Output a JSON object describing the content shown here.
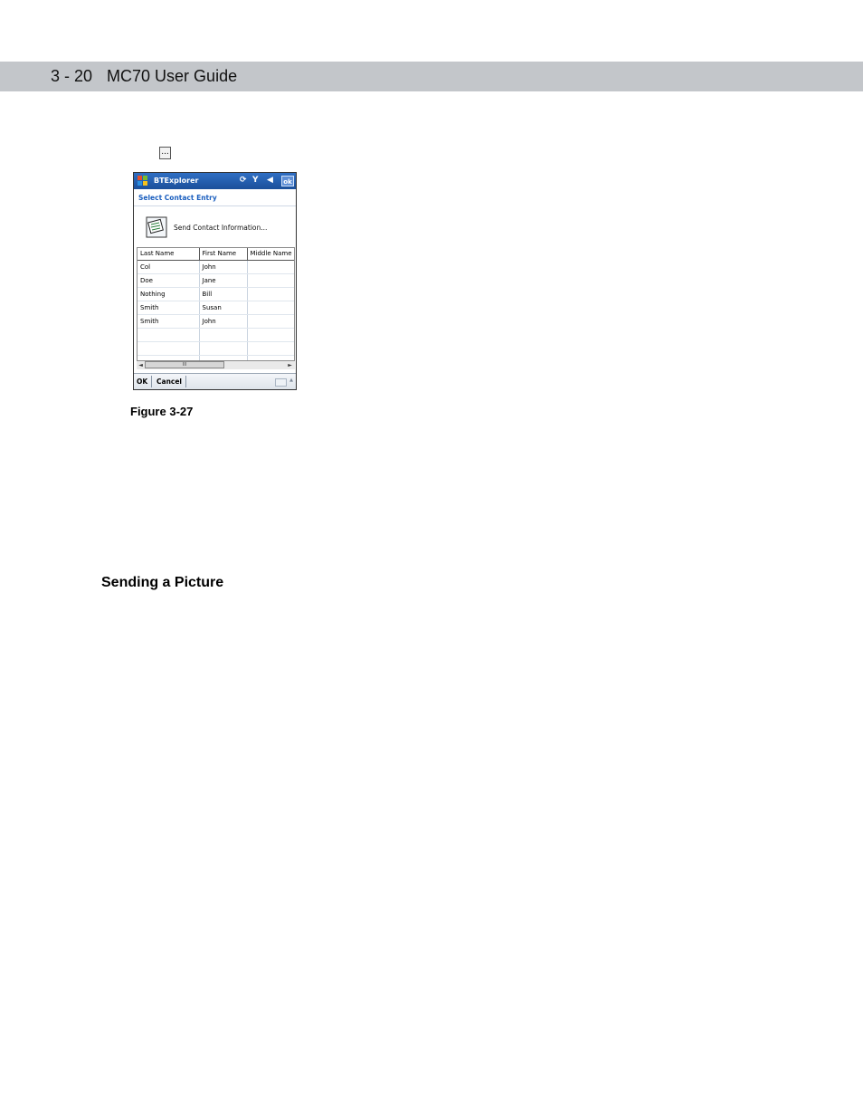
{
  "header": {
    "page_number": "3 - 20",
    "guide_title": "MC70 User Guide"
  },
  "inline_button": {
    "label": "..."
  },
  "device": {
    "app_title": "BTExplorer",
    "ok_label": "ok",
    "subheader": "Select Contact Entry",
    "send_label": "Send Contact Information...",
    "columns": [
      "Last Name",
      "First Name",
      "Middle Name"
    ],
    "rows": [
      [
        "Col",
        "John",
        ""
      ],
      [
        "Doe",
        "Jane",
        ""
      ],
      [
        "Nothing",
        "Bill",
        ""
      ],
      [
        "Smith",
        "Susan",
        ""
      ],
      [
        "Smith",
        "John",
        ""
      ],
      [
        "",
        "",
        ""
      ],
      [
        "",
        "",
        ""
      ],
      [
        "",
        "",
        ""
      ]
    ],
    "menu": {
      "ok": "OK",
      "cancel": "Cancel"
    },
    "scrollbar": {
      "left": "◄",
      "thumb": "III",
      "right": "►"
    },
    "icons": [
      "windows-flag-icon",
      "sync-icon",
      "signal-icon",
      "speaker-icon",
      "contact-card-icon",
      "keyboard-icon"
    ]
  },
  "figure": {
    "caption": "Figure 3-27"
  },
  "section": {
    "heading": "Sending a Picture"
  }
}
